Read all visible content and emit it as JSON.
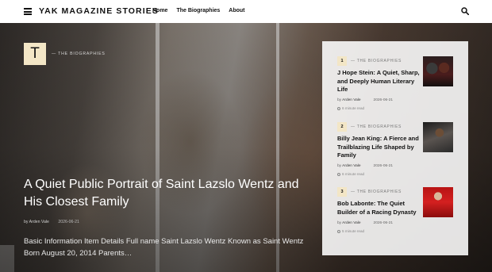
{
  "header": {
    "brand": "YAK MAGAZINE STORIES",
    "nav": [
      "Home",
      "The Biographies",
      "About"
    ]
  },
  "hero": {
    "category_letter": "T",
    "category": "— THE BIOGRAPHIES",
    "title": "A Quiet Public Portrait of Saint Lazslo Wentz and His Closest Family",
    "author_prefix": "by",
    "author": "Arden Vale",
    "date": "2026-06-21",
    "excerpt": "Basic Information Item Details Full name Saint Lazslo Wentz Known as Saint Wentz Born August 20, 2014 Parents…"
  },
  "side_list": [
    {
      "number": "1",
      "category": "— THE BIOGRAPHIES",
      "title": "J Hope Stein: A Quiet, Sharp, and Deeply Human Literary Life",
      "author_prefix": "by",
      "author": "Arden Vale",
      "date": "2026-06-21",
      "read_time": "6 minute read"
    },
    {
      "number": "2",
      "category": "— THE BIOGRAPHIES",
      "title": "Billy Jean King: A Fierce and Trailblazing Life Shaped by Family",
      "author_prefix": "by",
      "author": "Arden Vale",
      "date": "2026-06-21",
      "read_time": "6 minute read"
    },
    {
      "number": "3",
      "category": "— THE BIOGRAPHIES",
      "title": "Bob Labonte: The Quiet Builder of a Racing Dynasty",
      "author_prefix": "by",
      "author": "Arden Vale",
      "date": "2026-06-21",
      "read_time": "5 minute read"
    }
  ],
  "colors": {
    "badge": "#f3e6c6",
    "text_dark": "#111111"
  },
  "icons": {
    "menu": "menu-icon",
    "search": "search-icon",
    "clock": "clock-icon"
  }
}
